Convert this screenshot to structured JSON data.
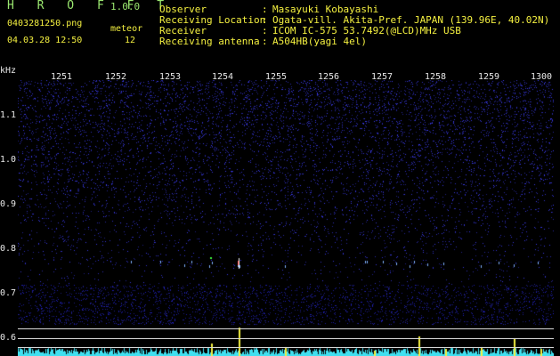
{
  "app": {
    "title": "H R O F F T",
    "version": "1.0.0",
    "filename": "0403281250.png",
    "datetime": "04.03.28 12:50",
    "meteor_label": "meteor",
    "meteor_count": "12"
  },
  "header": {
    "rows": [
      {
        "label": "Observer",
        "value": "Masayuki Kobayashi"
      },
      {
        "label": "Receiving Location",
        "value": "Ogata-vill. Akita-Pref. JAPAN (139.96E, 40.02N)"
      },
      {
        "label": "Receiver",
        "value": "ICOM IC-575 53.7492(@LCD)MHz USB"
      },
      {
        "label": "Receiving antenna",
        "value": "A504HB(yagi 4el)"
      }
    ],
    "colon": ":"
  },
  "spectrogram": {
    "y_unit": "kHz",
    "x_ticks": [
      "1251",
      "1252",
      "1253",
      "1254",
      "1255",
      "1256",
      "1257",
      "1258",
      "1259",
      "1300"
    ],
    "y_ticks": [
      "1.1",
      "1.0",
      "0.9",
      "0.8",
      "0.7",
      "0.6"
    ],
    "colors": {
      "background": "#000000",
      "noise": "#2a2ad8",
      "echo": "#ffffff",
      "label": "#9be870",
      "highlight": "#f4f040",
      "signal_bar": "#f4f040",
      "baseline": "#40e0f0"
    }
  }
}
